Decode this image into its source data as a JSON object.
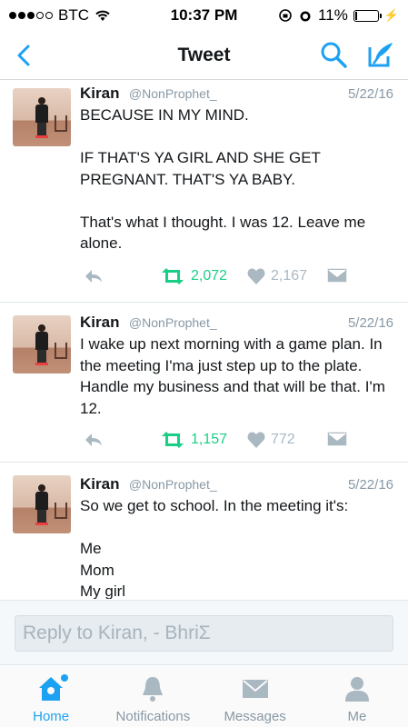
{
  "status_bar": {
    "carrier": "BTC",
    "time": "10:37 PM",
    "battery_percent": "11%",
    "battery_level": 0.11
  },
  "nav": {
    "title": "Tweet"
  },
  "tweets": [
    {
      "name": "Kiran",
      "handle": "@NonProphet_",
      "date": "5/22/16",
      "text": "BECAUSE IN MY MIND.\n\nIF THAT'S YA GIRL AND SHE GET PREGNANT. THAT'S YA BABY.\n\nThat's what I thought. I was 12. Leave me alone.",
      "retweets": "2,072",
      "likes": "2,167"
    },
    {
      "name": "Kiran",
      "handle": "@NonProphet_",
      "date": "5/22/16",
      "text": "I wake up next morning with a game plan. In the meeting I'ma just step up to the plate. Handle my business and that will be that. I'm 12.",
      "retweets": "1,157",
      "likes": "772"
    },
    {
      "name": "Kiran",
      "handle": "@NonProphet_",
      "date": "5/22/16",
      "text": "So we get to school. In the meeting it's:\n\nMe\nMom\nMy girl"
    }
  ],
  "reply": {
    "placeholder": "Reply to Kiran, - BhriΣ"
  },
  "tabs": {
    "home": "Home",
    "notifications": "Notifications",
    "messages": "Messages",
    "me": "Me"
  },
  "colors": {
    "accent": "#1da1f2",
    "retweet": "#19cf86",
    "muted": "#8899a6"
  }
}
